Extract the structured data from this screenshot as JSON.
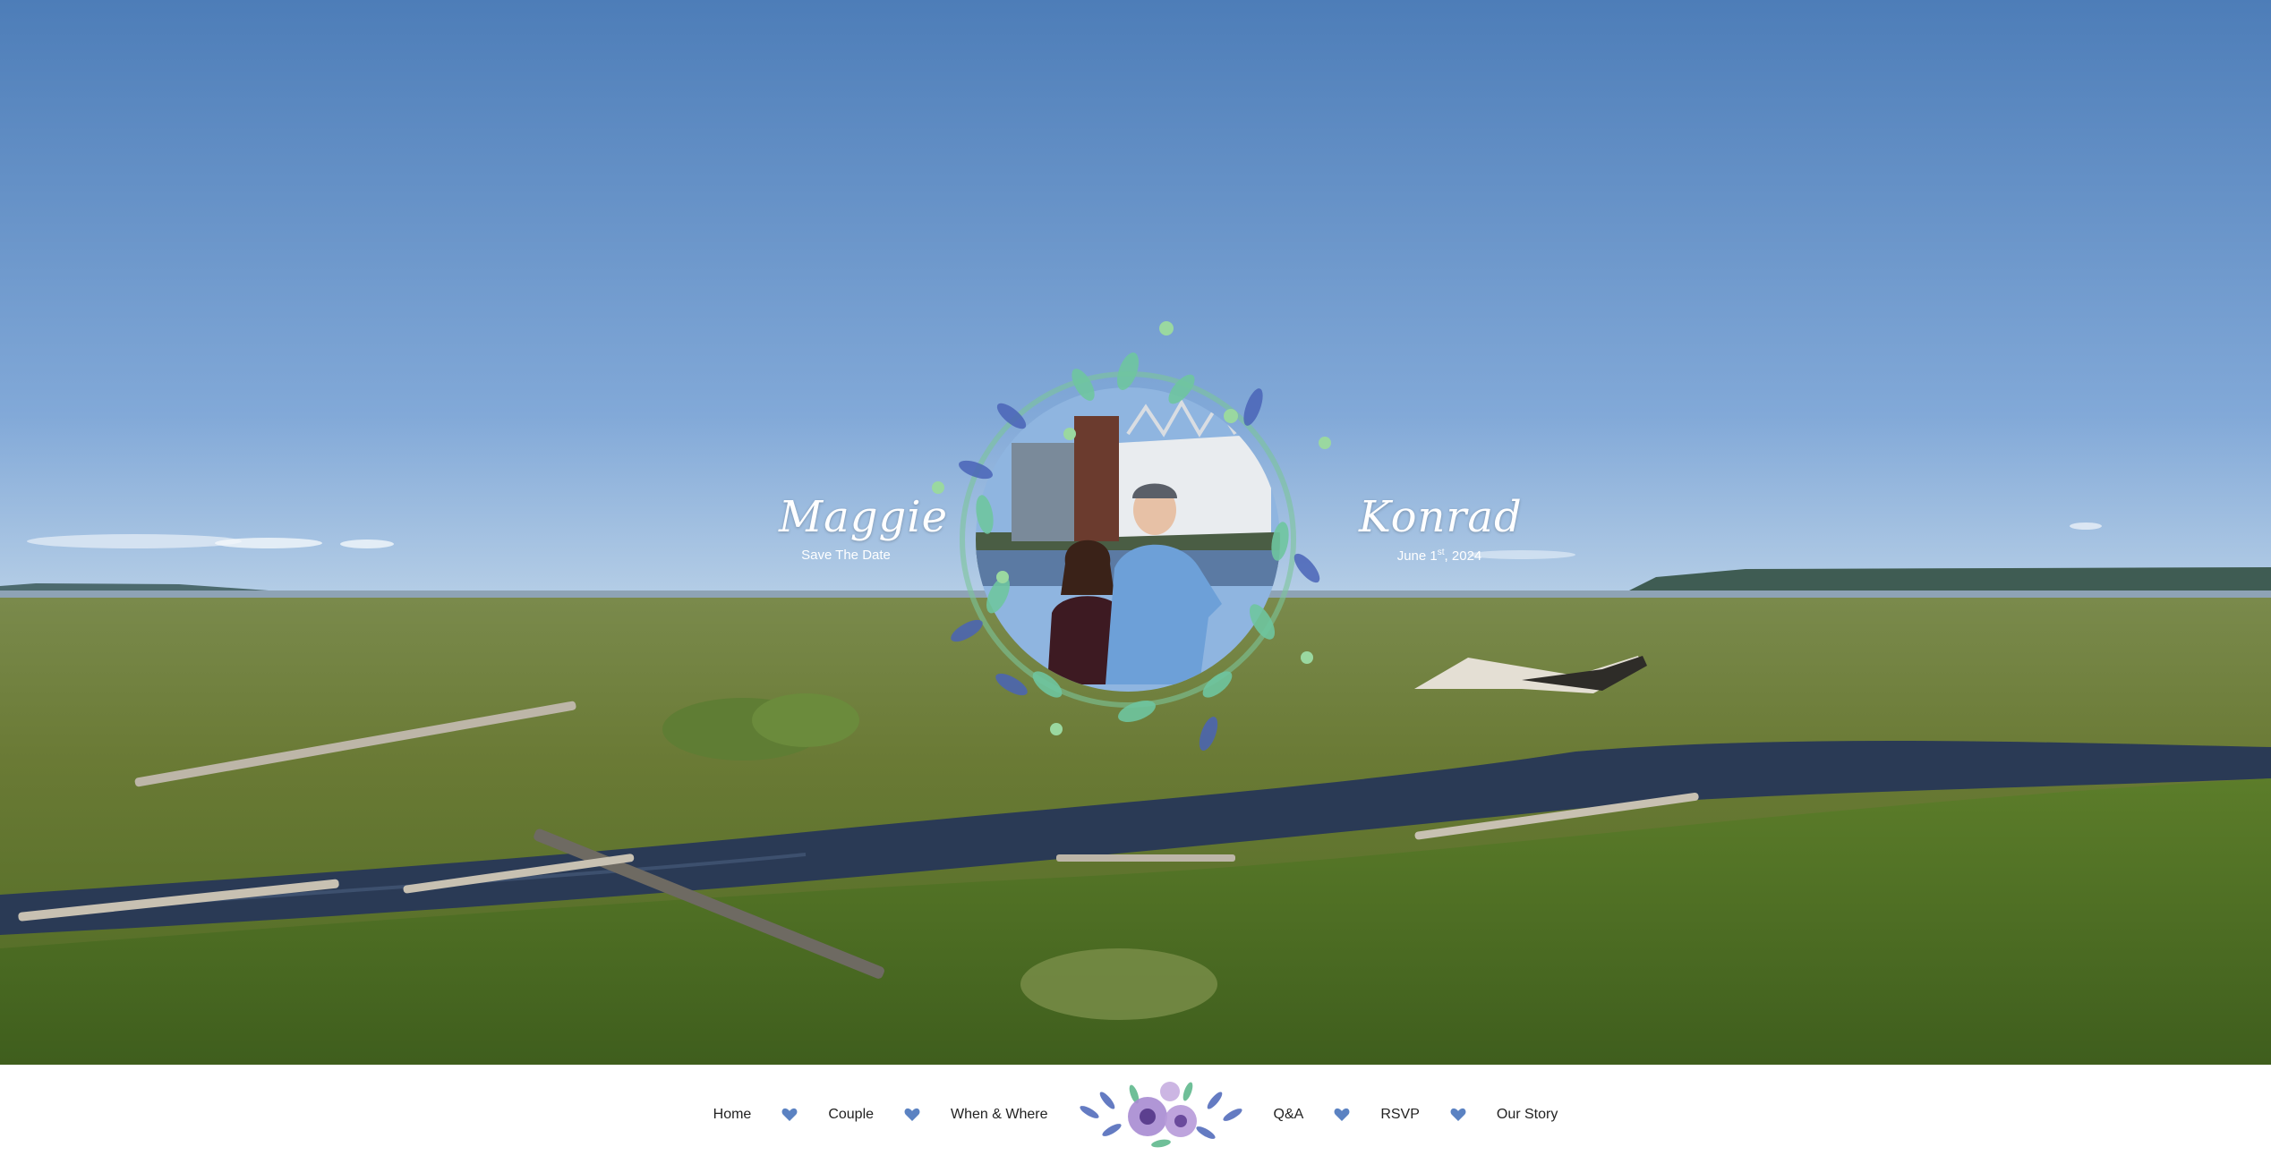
{
  "couple": {
    "bride": "Maggie",
    "groom": "Konrad",
    "save_the_date": "Save The Date",
    "date_prefix": "June 1",
    "date_suffix": "st",
    "date_year": ", 2024"
  },
  "nav": {
    "left": [
      {
        "label": "Home"
      },
      {
        "label": "Couple"
      },
      {
        "label": "When & Where"
      }
    ],
    "right": [
      {
        "label": "Q&A"
      },
      {
        "label": "RSVP"
      },
      {
        "label": "Our Story"
      }
    ]
  },
  "icons": {
    "separator": "heart-icon",
    "logo": "flower-bouquet-icon",
    "wreath": "floral-wreath"
  },
  "colors": {
    "sky_top": "#4f7fb9",
    "sky_bottom": "#a8c6e6",
    "grass": "#6e7d3a",
    "water": "#2b3a55",
    "heart": "#5b82c2",
    "nav_text": "#222222"
  }
}
